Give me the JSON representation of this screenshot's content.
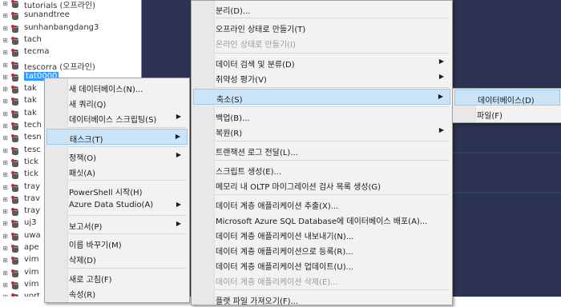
{
  "tree": {
    "items": [
      {
        "label": "tutorials (오프라인)",
        "selected": false
      },
      {
        "label": "sunandtree",
        "selected": false
      },
      {
        "label": "sunhanbangdang3",
        "selected": false
      },
      {
        "label": "tach",
        "selected": false
      },
      {
        "label": "tecma",
        "selected": false
      },
      {
        "label": "tescorra (오프라인)",
        "selected": false
      },
      {
        "label": "tat0000",
        "selected": true
      },
      {
        "label": "tak",
        "selected": false
      },
      {
        "label": "tak",
        "selected": false
      },
      {
        "label": "tak",
        "selected": false
      },
      {
        "label": "tech",
        "selected": false
      },
      {
        "label": "tesn",
        "selected": false
      },
      {
        "label": "tesc",
        "selected": false
      },
      {
        "label": "tick",
        "selected": false
      },
      {
        "label": "tick",
        "selected": false
      },
      {
        "label": "tray",
        "selected": false
      },
      {
        "label": "trav",
        "selected": false
      },
      {
        "label": "tray",
        "selected": false
      },
      {
        "label": "uj3",
        "selected": false
      },
      {
        "label": "uwa",
        "selected": false
      },
      {
        "label": "ape",
        "selected": false
      },
      {
        "label": "vim",
        "selected": false
      },
      {
        "label": "vim",
        "selected": false
      },
      {
        "label": "vim",
        "selected": false
      },
      {
        "label": "vort",
        "selected": false
      }
    ]
  },
  "context_menu": {
    "items": [
      {
        "label": "새 데이터베이스(N)...",
        "submenu": false
      },
      {
        "label": "새 쿼리(Q)",
        "submenu": false
      },
      {
        "label": "데이터베이스 스크립팅(S)",
        "submenu": true
      },
      {
        "label": "태스크(T)",
        "submenu": true,
        "highlighted": true
      },
      {
        "label": "정책(O)",
        "submenu": true
      },
      {
        "label": "패싯(A)",
        "submenu": false
      },
      {
        "label": "PowerShell 시작(H)",
        "submenu": false
      },
      {
        "label": "Azure Data Studio(A)",
        "submenu": true
      },
      {
        "label": "보고서(P)",
        "submenu": true
      },
      {
        "label": "이름 바꾸기(M)",
        "submenu": false
      },
      {
        "label": "삭제(D)",
        "submenu": false
      },
      {
        "label": "새로 고침(F)",
        "submenu": false
      },
      {
        "label": "속성(R)",
        "submenu": false
      }
    ]
  },
  "tasks_menu": {
    "items": [
      {
        "label": "분리(D)...",
        "submenu": false
      },
      {
        "label": "오프라인 상태로 만들기(T)",
        "submenu": false
      },
      {
        "label": "온라인 상태로 만들기(I)",
        "submenu": false,
        "disabled": true
      },
      {
        "label": "데이터 검색 및 분류(D)",
        "submenu": true
      },
      {
        "label": "취약성 평가(V)",
        "submenu": true
      },
      {
        "label": "축소(S)",
        "submenu": true,
        "highlighted": true
      },
      {
        "label": "백업(B)...",
        "submenu": false
      },
      {
        "label": "복원(R)",
        "submenu": true
      },
      {
        "label": "트랜잭션 로그 전달(L)...",
        "submenu": false
      },
      {
        "label": "스크립트 생성(E)...",
        "submenu": false
      },
      {
        "label": "메모리 내 OLTP 마이그레이션 검사 목록 생성(G)",
        "submenu": false
      },
      {
        "label": "데이터 계층 애플리케이션 추출(X)...",
        "submenu": false
      },
      {
        "label": "Microsoft Azure SQL Database에 데이터베이스 배포(A)...",
        "submenu": false
      },
      {
        "label": "데이터 계층 애플리케이션 내보내기(N)...",
        "submenu": false
      },
      {
        "label": "데이터 계층 애플리케이션으로 등록(R)...",
        "submenu": false
      },
      {
        "label": "데이터 계층 애플리케이션 업데이트(U)...",
        "submenu": false
      },
      {
        "label": "데이터 계층 애플리케이션 삭제(E)...",
        "submenu": false,
        "disabled": true
      },
      {
        "label": "플랫 파일 가져오기(F)...",
        "submenu": false
      }
    ]
  },
  "shrink_menu": {
    "items": [
      {
        "label": "데이터베이스(D)",
        "highlighted": true
      },
      {
        "label": "파일(F)",
        "highlighted": false
      }
    ]
  },
  "colors": {
    "background": "#2b3252",
    "menu_bg": "#f2f2f2",
    "highlight": "#cce4f7",
    "tree_selection": "#3399ff"
  },
  "icons": {
    "submenu_arrow": "triangle-right",
    "database": "database-icon",
    "expand": "expand-icon"
  }
}
